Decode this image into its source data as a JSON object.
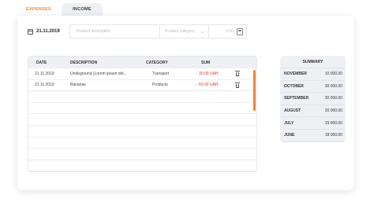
{
  "tabs": {
    "expenses": "EXPENSES",
    "income": "INCOME"
  },
  "date_value": "21.11.2019",
  "form": {
    "description_placeholder": "Product description",
    "category_placeholder": "Product category",
    "sum_placeholder": "0.00"
  },
  "table": {
    "headers": {
      "date": "DATE",
      "description": "DESCRIPTION",
      "category": "CATEGORY",
      "sum": "SUM"
    },
    "rows": [
      {
        "date": "21.11.2019",
        "description": "Undeground (Lorem ipsum dol...",
        "category": "Transport",
        "sum": "- 30.00 UAH."
      },
      {
        "date": "21.11.2019",
        "description": "Bananas",
        "category": "Products",
        "sum": "- 50.00 UAH."
      }
    ]
  },
  "summary": {
    "title": "SUMMARY",
    "rows": [
      {
        "month": "NOVEMBER",
        "value": "10 000.00"
      },
      {
        "month": "OCTOBER",
        "value": "30 000.00"
      },
      {
        "month": "SEPTEMBER",
        "value": "30 000.00"
      },
      {
        "month": "AUGUST",
        "value": "20 000.00"
      },
      {
        "month": "JULY",
        "value": "15 000.00"
      },
      {
        "month": "JUNE",
        "value": "18 000.00"
      }
    ]
  },
  "colors": {
    "accent": "#f0842c",
    "negative": "#d33333"
  },
  "icons": {
    "date": "calendar-icon",
    "category": "chevron-down-icon",
    "sum": "calculator-icon",
    "delete": "trash-icon"
  }
}
